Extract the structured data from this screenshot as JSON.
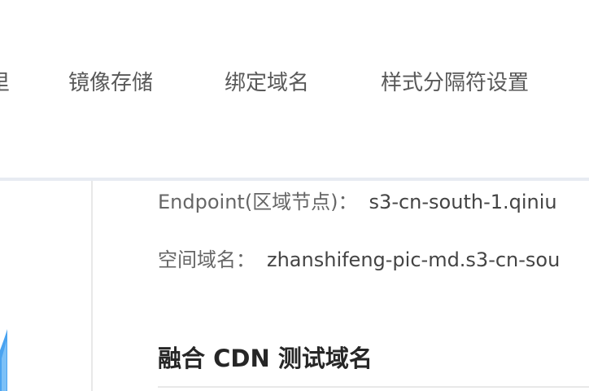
{
  "nav": {
    "tabs": [
      {
        "label": "里"
      },
      {
        "label": "镜像存储"
      },
      {
        "label": "绑定域名"
      },
      {
        "label": "样式分隔符设置"
      }
    ]
  },
  "details": {
    "endpoint_label": "Endpoint(区域节点)：",
    "endpoint_value": "s3-cn-south-1.qiniu",
    "domain_label": "空间域名：",
    "domain_value": "zhanshifeng-pic-md.s3-cn-sou"
  },
  "section": {
    "title": "融合 CDN 测试域名"
  },
  "colors": {
    "nav_text": "#595959",
    "divider": "#e7ebf2",
    "accent": "#4aa3f0"
  },
  "icons": {
    "side_decoration": "side-decoration-icon"
  }
}
